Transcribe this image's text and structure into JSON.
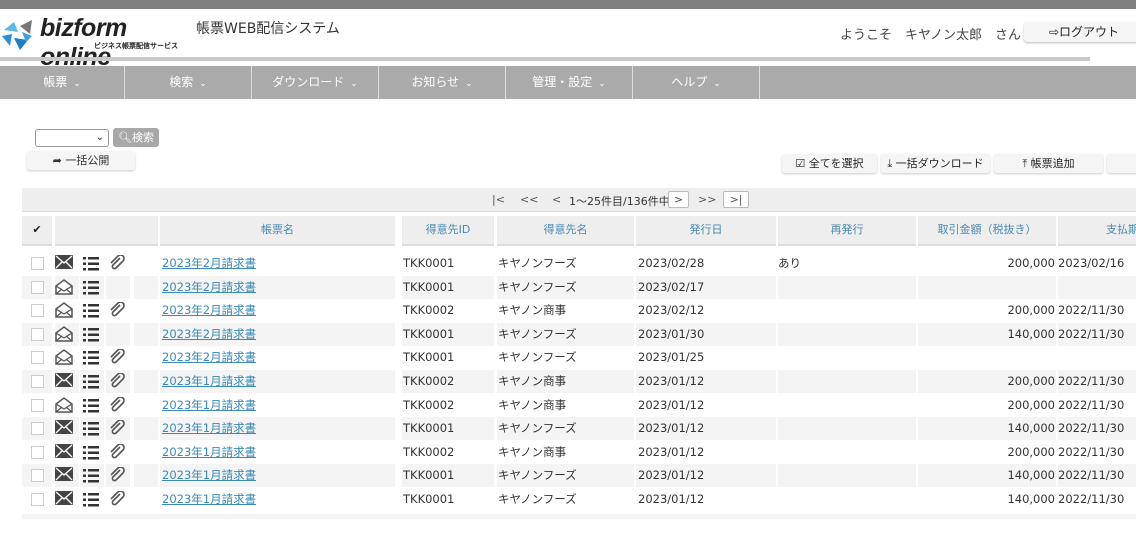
{
  "header": {
    "logo_text": "bizform online",
    "logo_sub": "ビジネス帳票配信サービス",
    "system_title": "帳票WEB配信システム",
    "welcome": "ようこそ　キヤノン太郎　さん",
    "logout": "ログアウト"
  },
  "menu": [
    {
      "label": "帳票"
    },
    {
      "label": "検索"
    },
    {
      "label": "ダウンロード"
    },
    {
      "label": "お知らせ"
    },
    {
      "label": "管理・設定"
    },
    {
      "label": "ヘルプ"
    }
  ],
  "toolbar": {
    "search": "検索",
    "select_value": "",
    "publish": "一括公開",
    "select_all": "全てを選択",
    "bulk_download": "一括ダウンロード",
    "add_form": "帳票追加"
  },
  "pager": {
    "first": "|<",
    "prev10": "<<",
    "prev": "<",
    "info": "1〜25件目/136件中",
    "next": ">",
    "next10": ">>",
    "last": ">|"
  },
  "columns": [
    "帳票名",
    "得意先ID",
    "得意先名",
    "発行日",
    "再発行",
    "取引金額（税抜き）",
    "支払期"
  ],
  "rows": [
    {
      "read": false,
      "attach": true,
      "name": "2023年2月請求書",
      "id": "TKK0001",
      "client": "キヤノンフーズ",
      "date": "2023/02/28",
      "reissue": "あり",
      "amount": "200,000",
      "pay": "2023/02/16"
    },
    {
      "read": true,
      "attach": false,
      "name": "2023年2月請求書",
      "id": "TKK0001",
      "client": "キヤノンフーズ",
      "date": "2023/02/17",
      "reissue": "",
      "amount": "",
      "pay": ""
    },
    {
      "read": true,
      "attach": true,
      "name": "2023年2月請求書",
      "id": "TKK0002",
      "client": "キヤノン商事",
      "date": "2023/02/12",
      "reissue": "",
      "amount": "200,000",
      "pay": "2022/11/30"
    },
    {
      "read": true,
      "attach": false,
      "name": "2023年2月請求書",
      "id": "TKK0001",
      "client": "キヤノンフーズ",
      "date": "2023/01/30",
      "reissue": "",
      "amount": "140,000",
      "pay": "2022/11/30"
    },
    {
      "read": true,
      "attach": true,
      "name": "2023年2月請求書",
      "id": "TKK0001",
      "client": "キヤノンフーズ",
      "date": "2023/01/25",
      "reissue": "",
      "amount": "",
      "pay": ""
    },
    {
      "read": false,
      "attach": true,
      "name": "2023年1月請求書",
      "id": "TKK0002",
      "client": "キヤノン商事",
      "date": "2023/01/12",
      "reissue": "",
      "amount": "200,000",
      "pay": "2022/11/30"
    },
    {
      "read": true,
      "attach": true,
      "name": "2023年1月請求書",
      "id": "TKK0002",
      "client": "キヤノン商事",
      "date": "2023/01/12",
      "reissue": "",
      "amount": "200,000",
      "pay": "2022/11/30"
    },
    {
      "read": false,
      "attach": true,
      "name": "2023年1月請求書",
      "id": "TKK0001",
      "client": "キヤノンフーズ",
      "date": "2023/01/12",
      "reissue": "",
      "amount": "140,000",
      "pay": "2022/11/30"
    },
    {
      "read": false,
      "attach": true,
      "name": "2023年1月請求書",
      "id": "TKK0002",
      "client": "キヤノン商事",
      "date": "2023/01/12",
      "reissue": "",
      "amount": "200,000",
      "pay": "2022/11/30"
    },
    {
      "read": false,
      "attach": true,
      "name": "2023年1月請求書",
      "id": "TKK0001",
      "client": "キヤノンフーズ",
      "date": "2023/01/12",
      "reissue": "",
      "amount": "140,000",
      "pay": "2022/11/30"
    },
    {
      "read": false,
      "attach": true,
      "name": "2023年1月請求書",
      "id": "TKK0001",
      "client": "キヤノンフーズ",
      "date": "2023/01/12",
      "reissue": "",
      "amount": "140,000",
      "pay": "2022/11/30"
    }
  ],
  "colors": {
    "menu": "#aaaaaa",
    "link": "#3a8ab5",
    "header_text": "#4a8ab0"
  }
}
